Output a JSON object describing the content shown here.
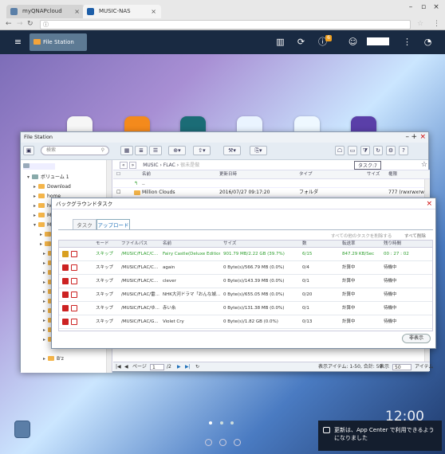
{
  "browser": {
    "tabs": [
      {
        "label": "myQNAPcloud"
      },
      {
        "label": "MUSIC-NAS"
      }
    ],
    "url": ""
  },
  "qts": {
    "app_button": "File Station",
    "notification_count": "6"
  },
  "filestation": {
    "title": "File Station",
    "search_placeholder": "検索",
    "breadcrumb": [
      "MUSIC",
      "FLAC",
      "很未是做"
    ],
    "task_label": "タスク:7",
    "columns": [
      "名前",
      "更新日時",
      "タイプ",
      "サイズ",
      "権限"
    ],
    "rows": [
      {
        "name": "..",
        "date": "",
        "type": "",
        "size": "",
        "perm": ""
      },
      {
        "name": "Million Clouds",
        "date": "2016/07/27 09:17:20",
        "type": "フォルダ",
        "size": "",
        "perm": "777 (rwxrwxrwx)"
      }
    ],
    "tree": [
      {
        "label": "ボリューム 1",
        "level": 1
      },
      {
        "label": "Download",
        "level": 2
      },
      {
        "label": "home",
        "level": 2
      },
      {
        "label": "hom",
        "level": 2
      },
      {
        "label": "Mult",
        "level": 2
      },
      {
        "label": "MUS",
        "level": 2
      },
      {
        "label": "B'z",
        "level": 3
      }
    ],
    "status": {
      "page_label": "ページ",
      "page": "1",
      "page_total": "/2",
      "items_info": "表示アイテム: 1-50, 合計: 59",
      "show_label": "表示",
      "per_page": "50",
      "items_label": "アイテム"
    }
  },
  "bgtask": {
    "title": "バックグラウンドタスク",
    "tabs": [
      {
        "label": "タスク"
      },
      {
        "label": "アップロード"
      }
    ],
    "link_stop_all": "すべての他のタスクを削除する",
    "link_delete_all": "すべて削除",
    "columns": [
      "モード",
      "ファイルパス",
      "名前",
      "サイズ",
      "数",
      "転送率",
      "残り時間"
    ],
    "rows": [
      {
        "mode": "スキップ",
        "path": "/MUSIC/FLAC/C...",
        "name": "Fairy Castle(Deluxe Edition...",
        "size": "901.79 MB/2.22 GB (39.7%)",
        "count": "6/15",
        "rate": "847.29 KB/Sec",
        "remain": "00 : 27 : 02",
        "active": true
      },
      {
        "mode": "スキップ",
        "path": "/MUSIC/FLAC/C...",
        "name": "again",
        "size": "0 Byte(s)/566.79 MB (0.0%)",
        "count": "0/4",
        "rate": "計算中",
        "remain": "待機中",
        "active": false
      },
      {
        "mode": "スキップ",
        "path": "/MUSIC/FLAC/C...",
        "name": "clever",
        "size": "0 Byte(s)/143.39 MB (0.0%)",
        "count": "0/1",
        "rate": "計算中",
        "remain": "待機中",
        "active": false
      },
      {
        "mode": "スキップ",
        "path": "/MUSIC/FLAC/雷...",
        "name": "NHK大河ドラマ「おんな城...",
        "size": "0 Byte(s)/655.05 MB (0.0%)",
        "count": "0/20",
        "rate": "計算中",
        "remain": "待機中",
        "active": false
      },
      {
        "mode": "スキップ",
        "path": "/MUSIC/FLAC/ゆ...",
        "name": "赤い糸",
        "size": "0 Byte(s)/131.38 MB (0.0%)",
        "count": "0/1",
        "rate": "計算中",
        "remain": "待機中",
        "active": false
      },
      {
        "mode": "スキップ",
        "path": "/MUSIC/FLAC/G...",
        "name": "Violet Cry",
        "size": "0 Byte(s)/1.82 GB (0.0%)",
        "count": "0/13",
        "rate": "計算中",
        "remain": "待機中",
        "active": false
      }
    ],
    "hide_button": "非表示"
  },
  "desktop": {
    "clock": "12:00",
    "notification": "更新は、App Center で利用できるようになりました"
  },
  "colors": {
    "accent": "#1d6fb8",
    "green": "#2a9d2a",
    "danger": "#cc2222"
  }
}
